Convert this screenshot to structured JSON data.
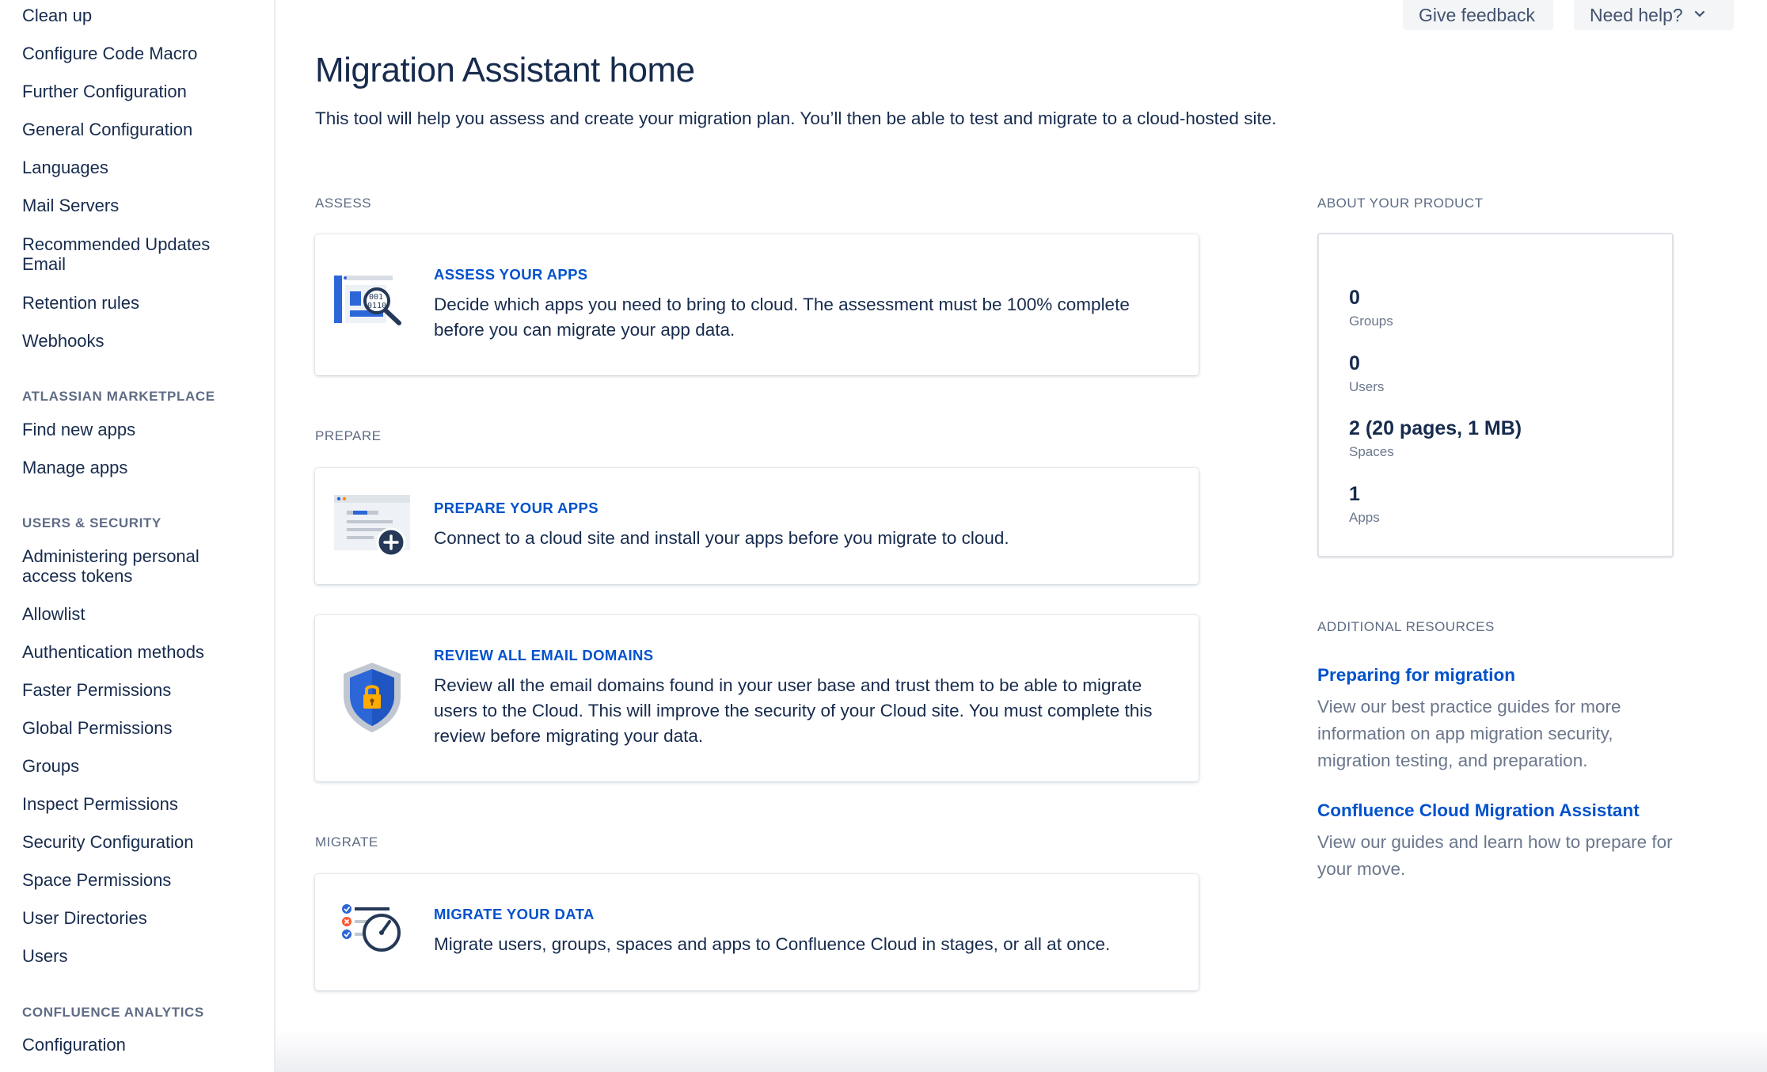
{
  "sidebar": {
    "items_top": [
      "Clean up",
      "Configure Code Macro",
      "Further Configuration",
      "General Configuration",
      "Languages",
      "Mail Servers",
      "Recommended Updates Email",
      "Retention rules",
      "Webhooks"
    ],
    "marketplace_heading": "ATLASSIAN MARKETPLACE",
    "marketplace_items": [
      "Find new apps",
      "Manage apps"
    ],
    "security_heading": "USERS & SECURITY",
    "security_items": [
      "Administering personal access tokens",
      "Allowlist",
      "Authentication methods",
      "Faster Permissions",
      "Global Permissions",
      "Groups",
      "Inspect Permissions",
      "Security Configuration",
      "Space Permissions",
      "User Directories",
      "Users"
    ],
    "analytics_heading": "CONFLUENCE ANALYTICS",
    "analytics_items": [
      "Configuration"
    ]
  },
  "header": {
    "feedback_label": "Give feedback",
    "help_label": "Need help?"
  },
  "main": {
    "title": "Migration Assistant home",
    "subtitle": "This tool will help you assess and create your migration plan. You’ll then be able to test and migrate to a cloud-hosted site.",
    "assess_label": "ASSESS",
    "prepare_label": "PREPARE",
    "migrate_label": "MIGRATE",
    "cards": [
      {
        "title": "ASSESS YOUR APPS",
        "desc": "Decide which apps you need to bring to cloud. The assessment must be 100% complete before you can migrate your app data.",
        "icon": "magnifier-binary-icon"
      },
      {
        "title": "PREPARE YOUR APPS",
        "desc": "Connect to a cloud site and install your apps before you migrate to cloud.",
        "icon": "add-app-icon"
      },
      {
        "title": "REVIEW ALL EMAIL DOMAINS",
        "desc": "Review all the email domains found in your user base and trust them to be able to migrate users to the Cloud. This will improve the security of your Cloud site. You must complete this review before migrating your data.",
        "icon": "shield-lock-icon"
      },
      {
        "title": "MIGRATE YOUR DATA",
        "desc": "Migrate users, groups, spaces and apps to Confluence Cloud in stages, or all at once.",
        "icon": "checklist-gauge-icon"
      }
    ]
  },
  "about": {
    "heading": "ABOUT YOUR PRODUCT",
    "stats": [
      {
        "value": "0",
        "label": "Groups"
      },
      {
        "value": "0",
        "label": "Users"
      },
      {
        "value": "2 (20 pages, 1 MB)",
        "label": "Spaces"
      },
      {
        "value": "1",
        "label": "Apps"
      }
    ]
  },
  "resources": {
    "heading": "ADDITIONAL RESOURCES",
    "items": [
      {
        "title": "Preparing for migration",
        "desc": "View our best practice guides for more information on app migration security, migration testing, and preparation."
      },
      {
        "title": "Confluence Cloud Migration Assistant",
        "desc": "View our guides and learn how to prepare for your move."
      }
    ]
  },
  "colors": {
    "link": "#0052cc",
    "text": "#172b4d",
    "subtle": "#5e6c84",
    "border": "#dfe1e6"
  }
}
